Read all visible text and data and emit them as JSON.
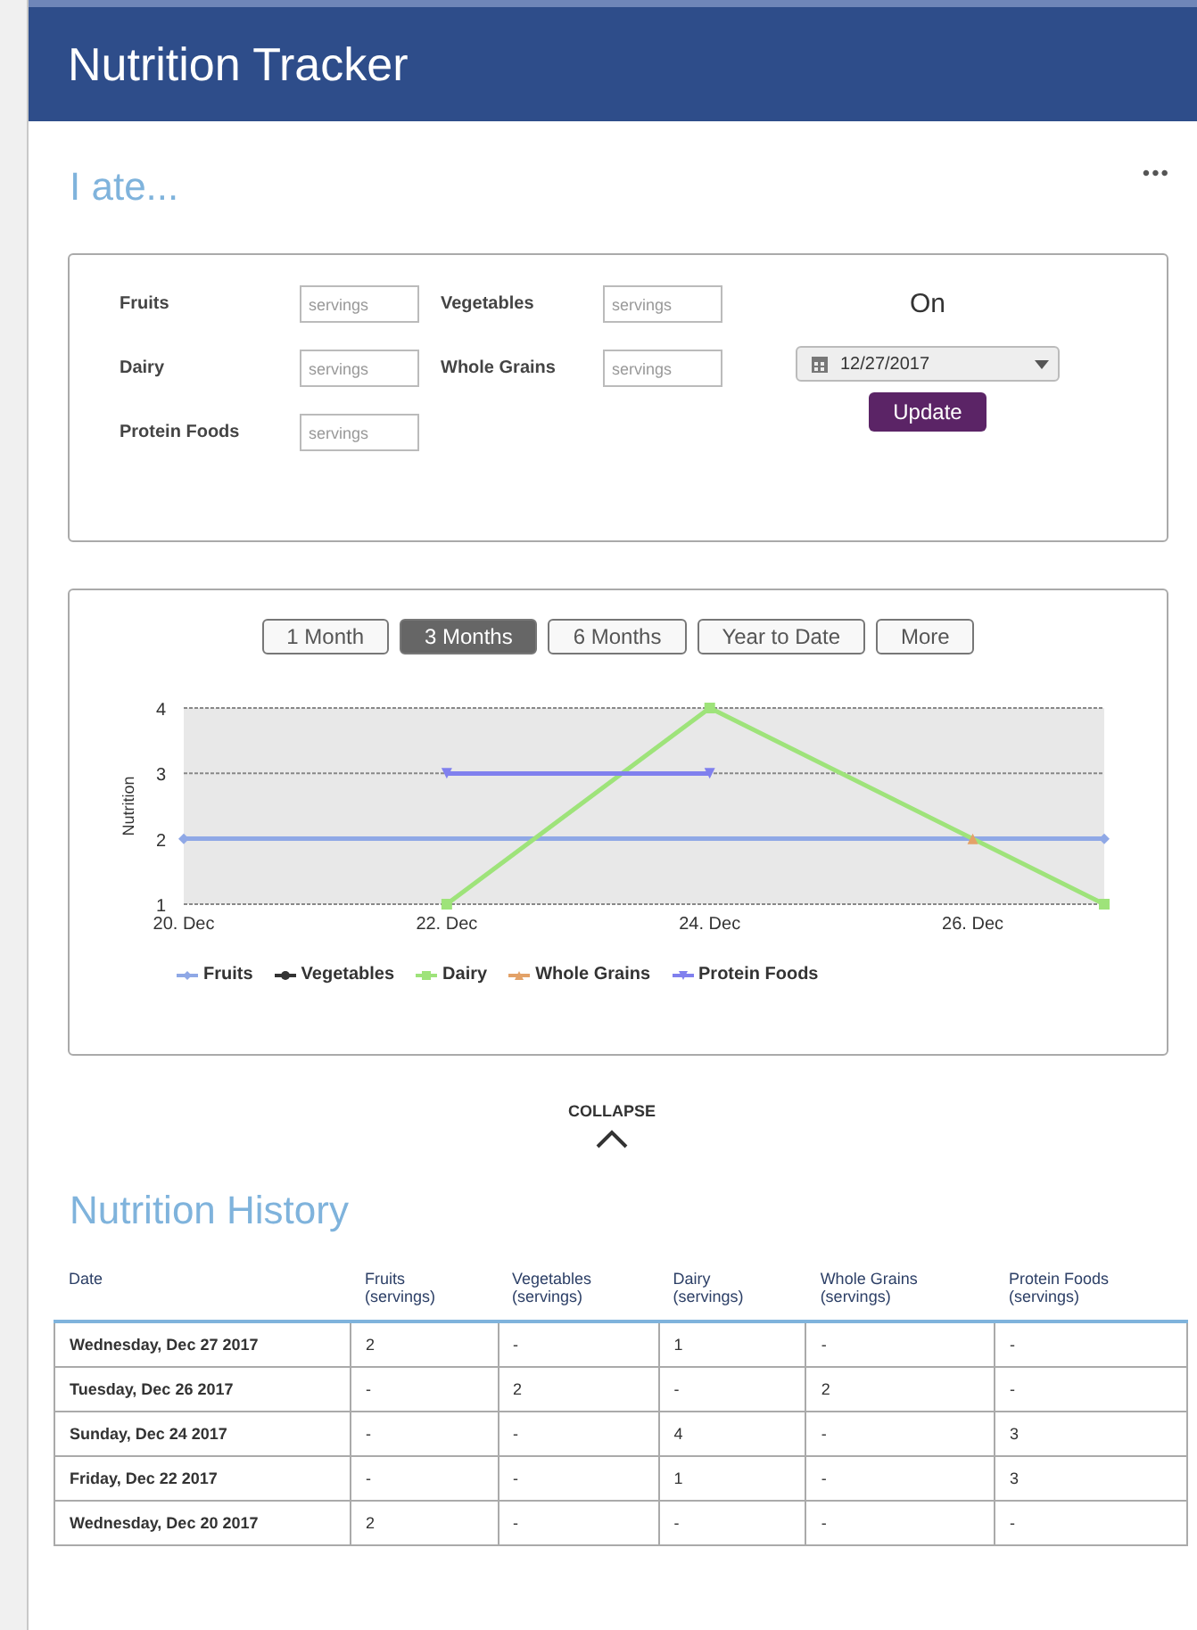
{
  "header": {
    "title": "Nutrition Tracker"
  },
  "section_title": "I ate...",
  "more_menu": "•••",
  "form": {
    "fields": [
      {
        "label": "Fruits",
        "placeholder": "servings"
      },
      {
        "label": "Vegetables",
        "placeholder": "servings"
      },
      {
        "label": "Dairy",
        "placeholder": "servings"
      },
      {
        "label": "Whole Grains",
        "placeholder": "servings"
      },
      {
        "label": "Protein Foods",
        "placeholder": "servings"
      }
    ],
    "on_label": "On",
    "date": "12/27/2017",
    "update_button": "Update"
  },
  "ranges": [
    {
      "label": "1 Month",
      "selected": false
    },
    {
      "label": "3 Months",
      "selected": true
    },
    {
      "label": "6 Months",
      "selected": false
    },
    {
      "label": "Year to Date",
      "selected": false
    },
    {
      "label": "More",
      "selected": false
    }
  ],
  "chart_data": {
    "type": "line",
    "ylabel": "Nutrition",
    "categories": [
      "20. Dec",
      null,
      "22. Dec",
      null,
      "24. Dec",
      null,
      "26. Dec",
      null
    ],
    "ylim": [
      1,
      4
    ],
    "yticks": [
      1,
      2,
      3,
      4
    ],
    "series": [
      {
        "name": "Fruits",
        "color": "#8fa8e6",
        "marker": "diamond",
        "values": [
          2,
          null,
          null,
          null,
          null,
          null,
          null,
          2
        ]
      },
      {
        "name": "Vegetables",
        "color": "#333333",
        "marker": "circle",
        "values": [
          null,
          null,
          null,
          null,
          null,
          null,
          null,
          null
        ]
      },
      {
        "name": "Dairy",
        "color": "#9ee37a",
        "marker": "square",
        "values": [
          null,
          null,
          1,
          null,
          4,
          null,
          null,
          1
        ]
      },
      {
        "name": "Whole Grains",
        "color": "#e3a268",
        "marker": "triangle",
        "values": [
          null,
          null,
          null,
          null,
          null,
          null,
          2,
          null
        ]
      },
      {
        "name": "Protein Foods",
        "color": "#8080ee",
        "marker": "triangle-down",
        "values": [
          null,
          null,
          3,
          null,
          3,
          null,
          null,
          null
        ]
      }
    ]
  },
  "collapse": "COLLAPSE",
  "history": {
    "title": "Nutrition History",
    "columns": [
      {
        "name": "Date"
      },
      {
        "name": "Fruits",
        "unit": "(servings)"
      },
      {
        "name": "Vegetables",
        "unit": "(servings)"
      },
      {
        "name": "Dairy",
        "unit": "(servings)"
      },
      {
        "name": "Whole Grains",
        "unit": "(servings)"
      },
      {
        "name": "Protein Foods",
        "unit": "(servings)"
      }
    ],
    "rows": [
      [
        "Wednesday, Dec 27 2017",
        "2",
        "-",
        "1",
        "-",
        "-"
      ],
      [
        "Tuesday, Dec 26 2017",
        "-",
        "2",
        "-",
        "2",
        "-"
      ],
      [
        "Sunday, Dec 24 2017",
        "-",
        "-",
        "4",
        "-",
        "3"
      ],
      [
        "Friday, Dec 22 2017",
        "-",
        "-",
        "1",
        "-",
        "3"
      ],
      [
        "Wednesday, Dec 20 2017",
        "2",
        "-",
        "-",
        "-",
        "-"
      ]
    ]
  }
}
